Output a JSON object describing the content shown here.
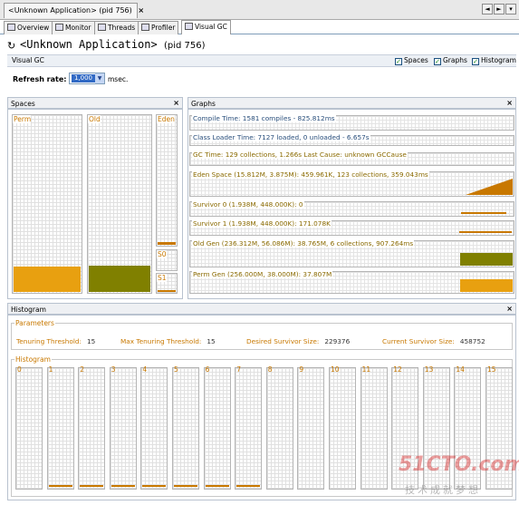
{
  "doc_tab": {
    "label": "<Unknown Application> (pid 756)",
    "close": "×"
  },
  "nav": {
    "left": "◄",
    "right": "►",
    "menu": "▾"
  },
  "subtabs": [
    "Overview",
    "Monitor",
    "Threads",
    "Profiler",
    "Visual GC"
  ],
  "header": {
    "title": "<Unknown Application>",
    "pid": "(pid 756)"
  },
  "visual_gc": {
    "label": "Visual GC",
    "checkboxes": [
      "Spaces",
      "Graphs",
      "Histogram"
    ],
    "check": "✓",
    "refresh_label": "Refresh rate:",
    "refresh_value": "1,000",
    "refresh_unit": "msec."
  },
  "spaces": {
    "title": "Spaces",
    "close": "×",
    "perm": {
      "name": "Perm",
      "fill": 0.15
    },
    "old": {
      "name": "Old",
      "fill": 0.16
    },
    "eden": {
      "name": "Eden",
      "fill": 0.02
    },
    "s0": {
      "name": "S0",
      "fill": 0.0
    },
    "s1": {
      "name": "S1",
      "fill": 0.2
    }
  },
  "graphs": {
    "title": "Graphs",
    "close": "×",
    "compile": "Compile Time: 1581 compiles - 825.812ms",
    "class_loader": "Class Loader Time: 7127 loaded, 0 unloaded - 6.657s",
    "gc_time": "GC Time: 129 collections, 1.266s  Last Cause: unknown GCCause",
    "eden": "Eden Space (15.812M, 3.875M): 459.961K, 123 collections, 359.043ms",
    "survivor0": "Survivor 0 (1.938M, 448.000K): 0",
    "survivor1": "Survivor 1 (1.938M, 448.000K): 171.078K",
    "old_gen": "Old Gen (236.312M, 56.086M): 38.765M, 6 collections, 907.264ms",
    "perm_gen": "Perm Gen (256.000M, 38.000M): 37.807M"
  },
  "histogram": {
    "title": "Histogram",
    "close": "×",
    "parameters_label": "Parameters",
    "tenuring_threshold_label": "Tenuring Threshold:",
    "tenuring_threshold": "15",
    "max_tenuring_label": "Max Tenuring Threshold:",
    "max_tenuring": "15",
    "desired_survivor_label": "Desired Survivor Size:",
    "desired_survivor": "229376",
    "current_survivor_label": "Current Survivor Size:",
    "current_survivor": "458752",
    "histogram_label": "Histogram",
    "bins": [
      "0",
      "1",
      "2",
      "3",
      "4",
      "5",
      "6",
      "7",
      "8",
      "9",
      "10",
      "11",
      "12",
      "13",
      "14",
      "15"
    ]
  },
  "watermark": {
    "main": "51CTO.com",
    "sub": "技术成就梦想"
  },
  "colors": {
    "perm": "#e8a010",
    "old": "#808000",
    "eden": "#c87800",
    "old_graph": "#808000",
    "perm_graph": "#e8a010"
  }
}
